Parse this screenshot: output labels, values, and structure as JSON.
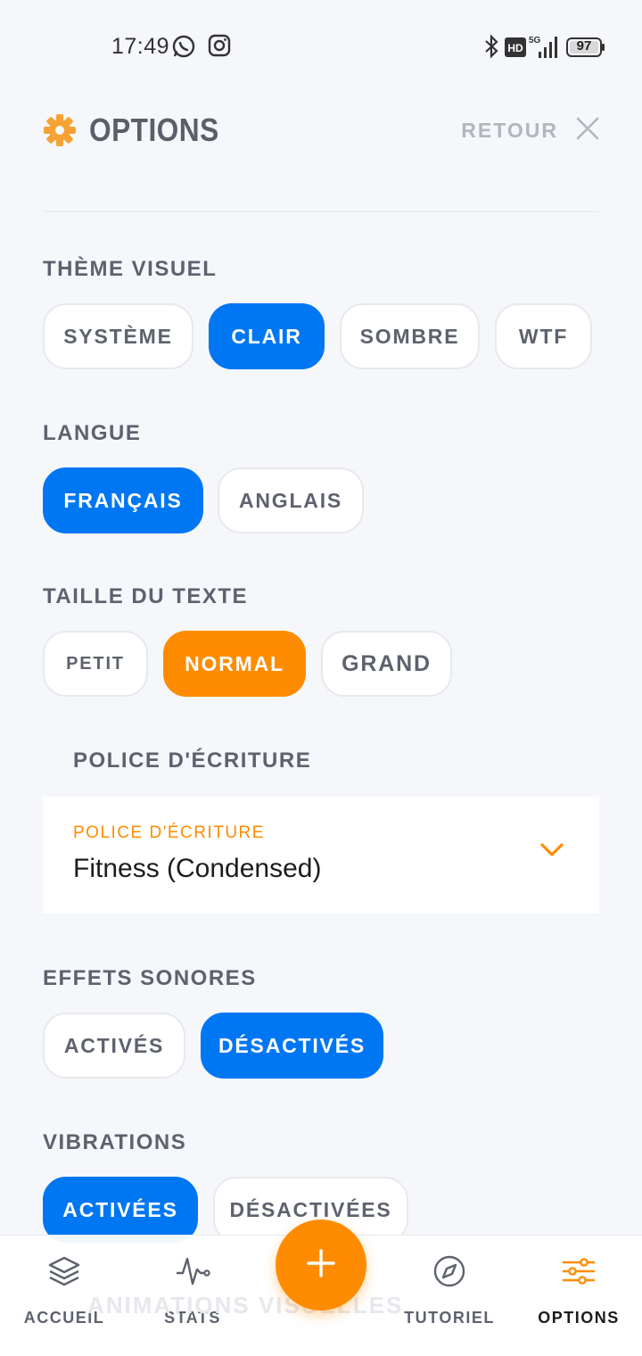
{
  "status_bar": {
    "time": "17:49",
    "battery": "97",
    "icons": [
      "whatsapp-icon",
      "instagram-icon",
      "bluetooth-icon",
      "hd-icon",
      "5g-icon",
      "signal-icon",
      "battery-icon"
    ]
  },
  "header": {
    "title": "OPTIONS",
    "back_label": "RETOUR",
    "icons": [
      "gear-icon",
      "close-icon"
    ]
  },
  "theme": {
    "label": "THÈME VISUEL",
    "options": [
      "SYSTÈME",
      "CLAIR",
      "SOMBRE",
      "WTF"
    ],
    "selected": "CLAIR"
  },
  "language": {
    "label": "LANGUE",
    "options": [
      "FRANÇAIS",
      "ANGLAIS"
    ],
    "selected": "FRANÇAIS"
  },
  "text_size": {
    "label": "TAILLE DU TEXTE",
    "options": [
      "PETIT",
      "NORMAL",
      "GRAND"
    ],
    "selected": "NORMAL"
  },
  "font": {
    "section_label": "POLICE D'ÉCRITURE",
    "field_caption": "POLICE D'ÉCRITURE",
    "value": "Fitness (Condensed)"
  },
  "sound": {
    "label": "EFFETS SONORES",
    "options": [
      "ACTIVÉS",
      "DÉSACTIVÉS"
    ],
    "selected": "DÉSACTIVÉS"
  },
  "vibrations": {
    "label": "VIBRATIONS",
    "options": [
      "ACTIVÉES",
      "DÉSACTIVÉES"
    ],
    "selected": "ACTIVÉES"
  },
  "next_section_partial": "ANIMATIONS VISUELLES",
  "bottom_nav": {
    "items": [
      {
        "label": "ACCUEIL",
        "icon": "layers-icon"
      },
      {
        "label": "STATS",
        "icon": "pulse-icon"
      },
      {
        "label": "TUTORIEL",
        "icon": "compass-icon"
      },
      {
        "label": "OPTIONS",
        "icon": "sliders-icon"
      }
    ],
    "active": "OPTIONS",
    "fab_icon": "plus-icon"
  },
  "colors": {
    "background": "#f5f7fa",
    "primary_blue": "#0077f2",
    "accent_orange": "#ff8c00",
    "text_gray": "#5d626d"
  }
}
